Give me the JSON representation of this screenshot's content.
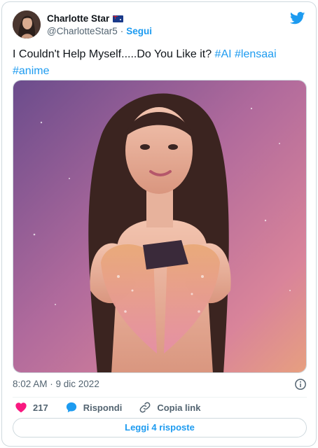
{
  "author": {
    "display_name": "Charlotte Star",
    "handle": "@CharlotteStar5",
    "separator": "·",
    "follow_label": "Segui",
    "flag_icon": "australia-flag-icon"
  },
  "tweet": {
    "text_plain": "I Couldn't Help Myself.....Do You Like it? ",
    "hashtags": [
      "#AI",
      "#lensaai",
      "#anime"
    ],
    "timestamp": "8:02 AM · 9 dic 2022"
  },
  "actions": {
    "like_count": "217",
    "reply_label": "Rispondi",
    "copy_link_label": "Copia link"
  },
  "replies_button_label": "Leggi 4 risposte",
  "colors": {
    "accent": "#1d9bf0",
    "like": "#f91880",
    "text": "#0f1419",
    "secondary": "#536471",
    "border": "#cfd9de"
  }
}
